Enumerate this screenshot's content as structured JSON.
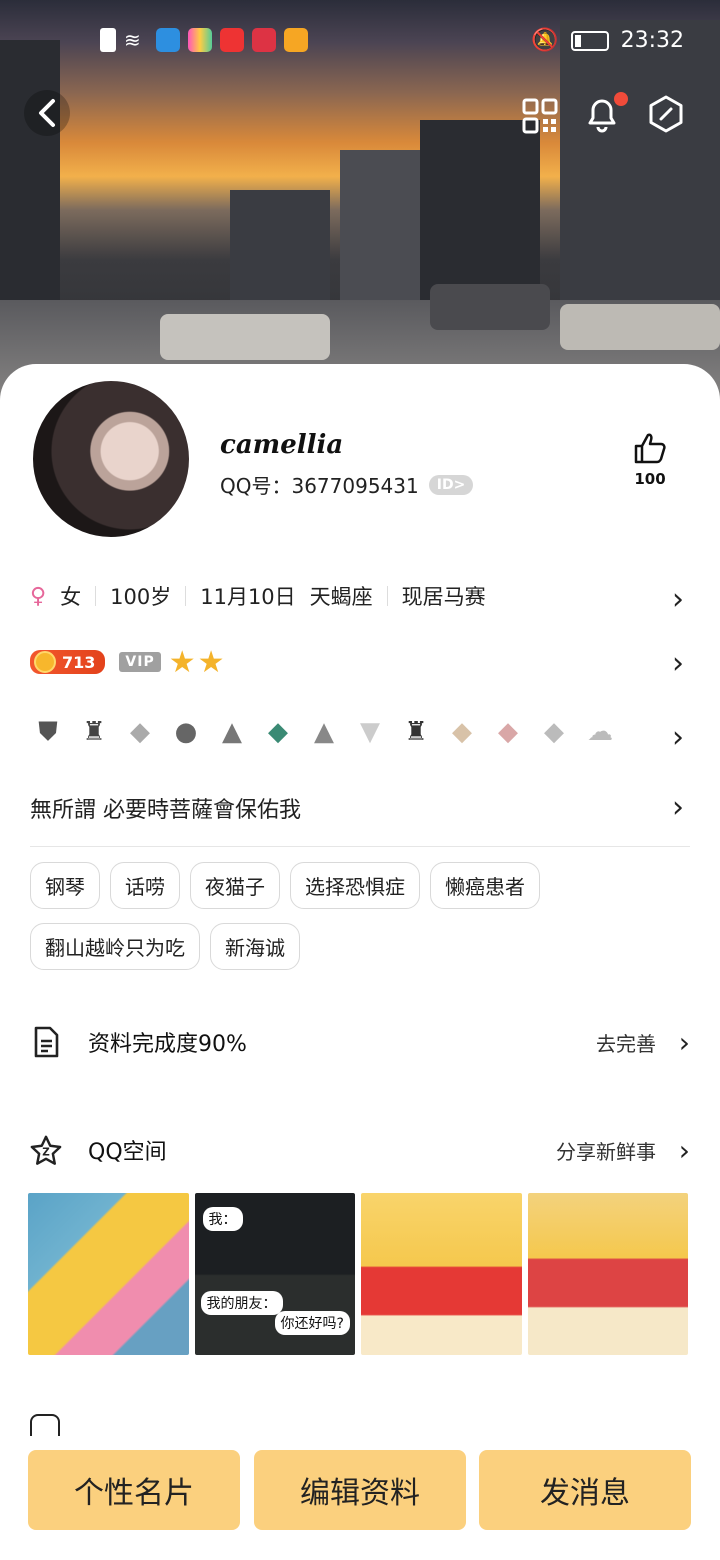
{
  "status": {
    "time": "23:32"
  },
  "profile": {
    "nickname": "camellia",
    "qq_label": "QQ号：3677095431",
    "id_badge": "ID>",
    "likes": "100"
  },
  "info": {
    "gender": "女",
    "age": "100岁",
    "birthday": "11月10日",
    "zodiac": "天蝎座",
    "location": "现居马赛"
  },
  "level": {
    "coin_value": "713",
    "vip_label": "VIP",
    "stars": 2
  },
  "medals": [
    "shield-icon",
    "bell-crown-icon",
    "diamond-icon",
    "bomb-icon",
    "mountain-icon",
    "gem-icon",
    "mountain-icon",
    "diamond-icon",
    "bell-crown-icon",
    "diamond-icon",
    "diamond-icon",
    "diamond-icon",
    "cloud-icon"
  ],
  "signature": "無所謂   必要時菩薩會保佑我",
  "tags": [
    "钢琴",
    "话唠",
    "夜猫子",
    "选择恐惧症",
    "懒癌患者",
    "翻山越岭只为吃",
    "新海诚"
  ],
  "completion": {
    "label": "资料完成度90%",
    "action": "去完善"
  },
  "qzone": {
    "title": "QQ空间",
    "action": "分享新鲜事"
  },
  "photo_texts": {
    "p2_top": "我：",
    "p2_bottom": "我的朋友：",
    "p2_bubble": "你还好吗?"
  },
  "buttons": {
    "card": "个性名片",
    "edit": "编辑资料",
    "message": "发消息"
  },
  "colors": {
    "accent": "#fbd07e",
    "coin": "#e3421b",
    "star": "#f4b32b"
  }
}
